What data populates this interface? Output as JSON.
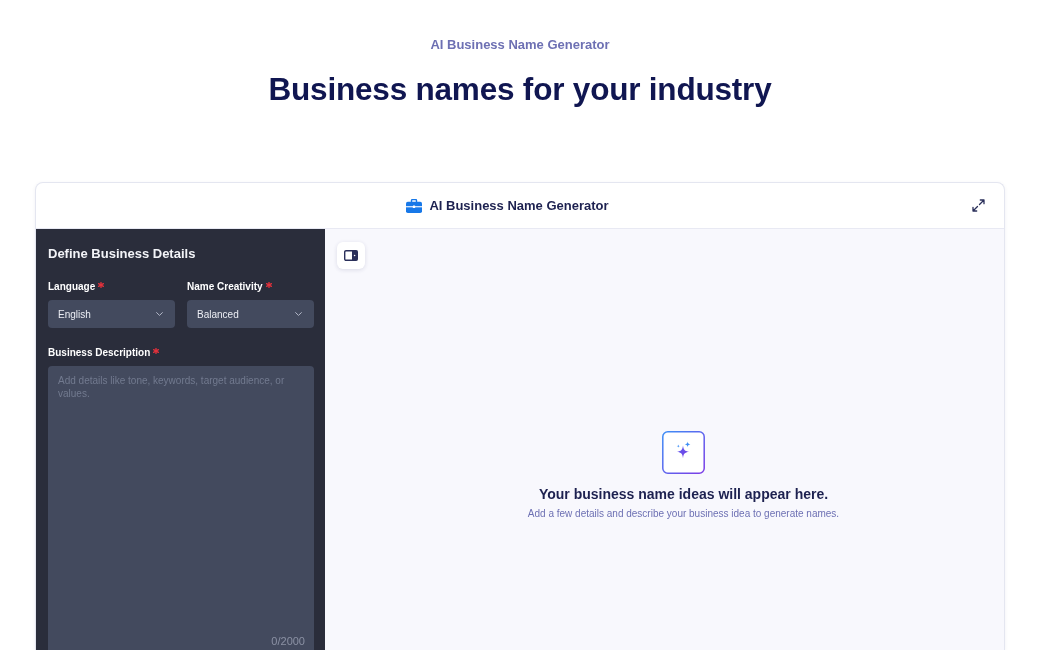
{
  "page_header": {
    "eyebrow": "AI Business Name Generator",
    "title": "Business names for your industry"
  },
  "app": {
    "title": "AI Business Name Generator"
  },
  "form": {
    "title": "Define Business Details",
    "fields": [
      {
        "kind": "select",
        "label": "Language",
        "required": true,
        "value": "English"
      },
      {
        "kind": "select",
        "label": "Name Creativity",
        "required": true,
        "value": "Balanced"
      },
      {
        "kind": "textarea",
        "label": "Business Description",
        "required": true,
        "placeholder": "Add details like tone, keywords, target audience, or values.",
        "counter": "0/2000"
      }
    ]
  },
  "results": {
    "empty_title": "Your business name ideas will appear here.",
    "empty_text": "Add a few details and describe your business idea to generate names."
  }
}
